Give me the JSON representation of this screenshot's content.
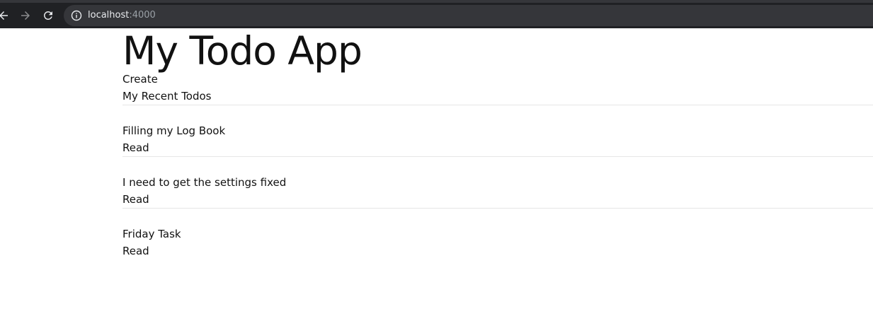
{
  "browser": {
    "url_host": "localhost",
    "url_port": ":4000"
  },
  "app": {
    "title": "My Todo App",
    "create_label": "Create",
    "recent_heading": "My Recent Todos",
    "todos": [
      {
        "title": "Filling my Log Book",
        "read_label": "Read"
      },
      {
        "title": "I need to get the settings fixed",
        "read_label": "Read"
      },
      {
        "title": "Friday Task",
        "read_label": "Read"
      }
    ]
  }
}
